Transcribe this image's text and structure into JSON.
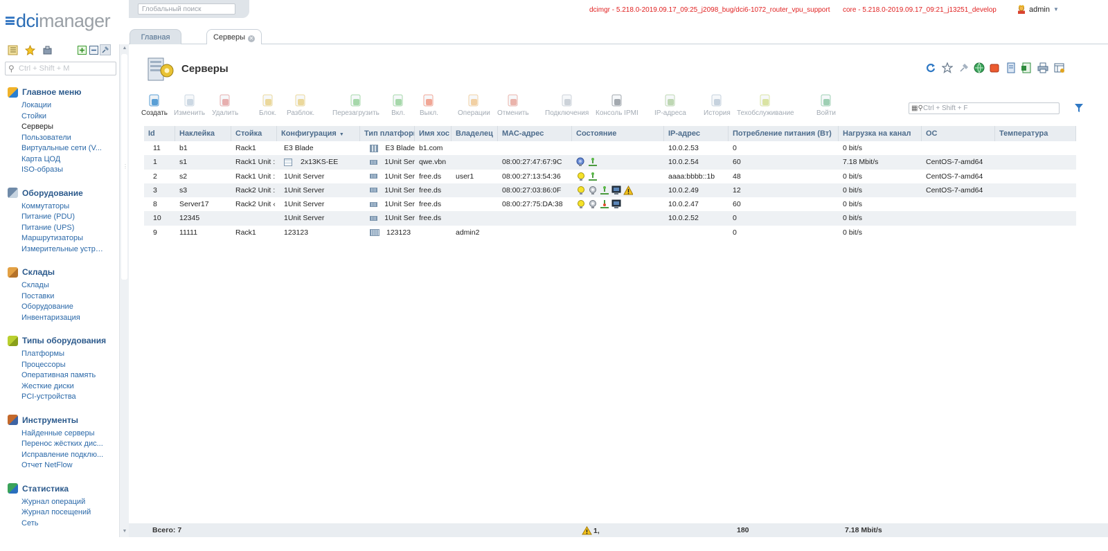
{
  "logo": {
    "part1": "dci",
    "part2": "manager"
  },
  "sidebar": {
    "search_placeholder": "Ctrl + Shift + M",
    "groups": [
      {
        "title": "Главное меню",
        "icon": "main-menu-icon",
        "items": [
          "Локации",
          "Стойки",
          "Серверы",
          "Пользователи",
          "Виртуальные сети (V...",
          "Карта ЦОД",
          "ISO-образы"
        ]
      },
      {
        "title": "Оборудование",
        "icon": "equipment-icon",
        "items": [
          "Коммутаторы",
          "Питание (PDU)",
          "Питание (UPS)",
          "Маршрутизаторы",
          "Измерительные устро..."
        ]
      },
      {
        "title": "Склады",
        "icon": "warehouse-icon",
        "items": [
          "Склады",
          "Поставки",
          "Оборудование",
          "Инвентаризация"
        ]
      },
      {
        "title": "Типы оборудования",
        "icon": "equipment-types-icon",
        "items": [
          "Платформы",
          "Процессоры",
          "Оперативная память",
          "Жесткие диски",
          "PCI-устройства"
        ]
      },
      {
        "title": "Инструменты",
        "icon": "tools-icon",
        "items": [
          "Найденные серверы",
          "Перенос жёстких дис...",
          "Исправление подклю...",
          "Отчет NetFlow"
        ]
      },
      {
        "title": "Статистика",
        "icon": "statistics-icon",
        "items": [
          "Журнал операций",
          "Журнал посещений",
          "Сеть"
        ]
      }
    ],
    "active_item": "Серверы"
  },
  "topbar": {
    "global_search_placeholder": "Глобальный поиск",
    "version_dcimgr": "dcimgr - 5.218.0-2019.09.17_09:25_j2098_bug/dci6-1072_router_vpu_support",
    "version_core": "core - 5.218.0-2019.09.17_09:21_j13251_develop",
    "user": "admin"
  },
  "tabs": [
    {
      "label": "Главная",
      "active": false
    },
    {
      "label": "Серверы",
      "active": true
    }
  ],
  "page": {
    "title": "Серверы",
    "filter_placeholder": "Ctrl + Shift + F"
  },
  "toolbar": [
    {
      "label": "Создать",
      "icon": "create-icon",
      "enabled": true
    },
    {
      "label": "Изменить",
      "icon": "edit-icon",
      "enabled": false
    },
    {
      "label": "Удалить",
      "icon": "delete-icon",
      "enabled": false
    },
    {
      "label": "Блок.",
      "icon": "lock-icon",
      "enabled": false
    },
    {
      "label": "Разблок.",
      "icon": "unlock-icon",
      "enabled": false
    },
    {
      "label": "Перезагрузить",
      "icon": "reboot-icon",
      "enabled": false
    },
    {
      "label": "Вкл.",
      "icon": "power-on-icon",
      "enabled": false
    },
    {
      "label": "Выкл.",
      "icon": "power-off-icon",
      "enabled": false
    },
    {
      "label": "Операции",
      "icon": "operations-icon",
      "enabled": false
    },
    {
      "label": "Отменить",
      "icon": "cancel-icon",
      "enabled": false
    },
    {
      "label": "Подключения",
      "icon": "connections-icon",
      "enabled": false
    },
    {
      "label": "Консоль IPMI",
      "icon": "ipmi-console-icon",
      "enabled": false
    },
    {
      "label": "IP-адреса",
      "icon": "ip-addresses-icon",
      "enabled": false
    },
    {
      "label": "История",
      "icon": "history-icon",
      "enabled": false
    },
    {
      "label": "Техобслуживание",
      "icon": "maintenance-icon",
      "enabled": false
    },
    {
      "label": "Войти",
      "icon": "login-icon",
      "enabled": false
    }
  ],
  "table": {
    "columns": [
      "Id",
      "Наклейка",
      "Стойка",
      "Конфигурация",
      "Тип платформ",
      "Имя хос",
      "Владелец",
      "МАС-адрес",
      "Состояние",
      "IP-адрес",
      "Потребление питания (Вт)",
      "Нагрузка на канал",
      "ОС",
      "Температура"
    ],
    "sorted_column": "Конфигурация",
    "rows": [
      {
        "id": "11",
        "label": "b1",
        "rack": "Rack1",
        "config": "E3 Blade",
        "config_icon": false,
        "platform": "E3 Blade",
        "platform_icon": "blade",
        "host": "b1.com",
        "owner": "",
        "mac": "",
        "status": [],
        "ip": "10.0.2.53",
        "power": "0",
        "load": "0 bit/s",
        "os": "",
        "temp": ""
      },
      {
        "id": "1",
        "label": "s1",
        "rack": "Rack1 Unit :",
        "config": "2x13KS-EE",
        "config_icon": true,
        "platform": "1Unit Ser",
        "platform_icon": "1u",
        "host": "qwe.vbn",
        "owner": "",
        "mac": "08:00:27:47:67:9C",
        "status": [
          "globe",
          "net"
        ],
        "ip": "10.0.2.54",
        "power": "60",
        "load": "7.18 Mbit/s",
        "os": "CentOS-7-amd64",
        "temp": ""
      },
      {
        "id": "2",
        "label": "s2",
        "rack": "Rack1 Unit :",
        "config": "1Unit Server",
        "config_icon": false,
        "platform": "1Unit Ser",
        "platform_icon": "1u",
        "host": "free.ds",
        "owner": "user1",
        "mac": "08:00:27:13:54:36",
        "status": [
          "bulb",
          "net"
        ],
        "ip": "aaaa:bbbb::1b",
        "power": "48",
        "load": "0 bit/s",
        "os": "CentOS-7-amd64",
        "temp": ""
      },
      {
        "id": "3",
        "label": "s3",
        "rack": "Rack2 Unit :",
        "config": "1Unit Server",
        "config_icon": false,
        "platform": "1Unit Ser",
        "platform_icon": "1u",
        "host": "free.ds",
        "owner": "",
        "mac": "08:00:27:03:86:0F",
        "status": [
          "bulb",
          "gear",
          "net",
          "monitor",
          "warning"
        ],
        "ip": "10.0.2.49",
        "power": "12",
        "load": "0 bit/s",
        "os": "CentOS-7-amd64",
        "temp": ""
      },
      {
        "id": "8",
        "label": "Server17",
        "rack": "Rack2 Unit ‹",
        "config": "1Unit Server",
        "config_icon": false,
        "platform": "1Unit Ser",
        "platform_icon": "1u",
        "host": "free.ds",
        "owner": "",
        "mac": "08:00:27:75:DA:38",
        "status": [
          "bulb",
          "gear",
          "net-red",
          "monitor"
        ],
        "ip": "10.0.2.47",
        "power": "60",
        "load": "0 bit/s",
        "os": "",
        "temp": ""
      },
      {
        "id": "10",
        "label": "12345",
        "rack": "",
        "config": "1Unit Server",
        "config_icon": false,
        "platform": "1Unit Ser",
        "platform_icon": "1u",
        "host": "free.ds",
        "owner": "",
        "mac": "",
        "status": [],
        "ip": "10.0.2.52",
        "power": "0",
        "load": "0 bit/s",
        "os": "",
        "temp": ""
      },
      {
        "id": "9",
        "label": "11111",
        "rack": "Rack1",
        "config": "123123",
        "config_icon": false,
        "platform": "123123",
        "platform_icon": "tall",
        "host": "",
        "owner": "admin2",
        "mac": "",
        "status": [],
        "ip": "",
        "power": "0",
        "load": "0 bit/s",
        "os": "",
        "temp": ""
      }
    ]
  },
  "footer": {
    "total": "Всего: 7",
    "warnings": "1,",
    "power_sum": "180",
    "load_sum": "7.18 Mbit/s"
  },
  "colors": {
    "link": "#2a68a8",
    "header_text": "#4d6c8c",
    "version_red": "#e01f1f",
    "alt_row": "#eef1f4"
  }
}
